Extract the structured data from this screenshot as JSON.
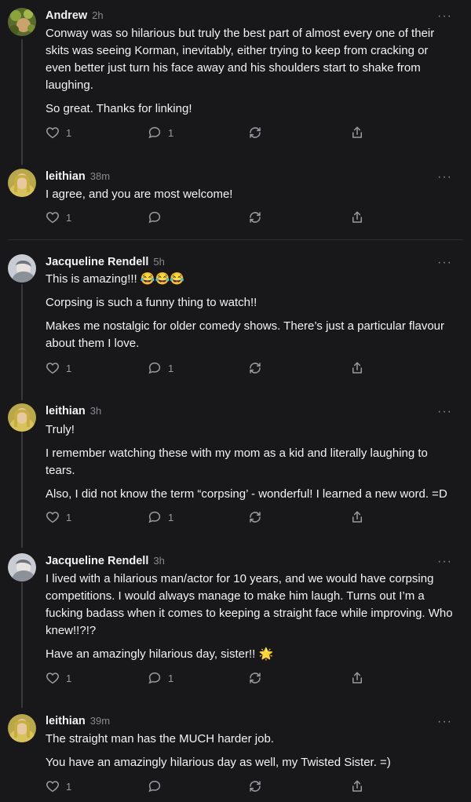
{
  "comments": [
    {
      "author": "Andrew",
      "time": "2h",
      "paragraphs": [
        "Conway was so hilarious but truly the best part of almost every one of their skits was seeing Korman, inevitably, either trying to keep from cracking or even better just turn his face away and his shoulders start to shake from laughing.",
        "So great. Thanks for linking!"
      ],
      "likes": "1",
      "replies": "1",
      "avatar": "leafy-avatar"
    },
    {
      "author": "leithian",
      "time": "38m",
      "paragraphs": [
        "I agree, and you are most welcome!"
      ],
      "likes": "1",
      "replies": "",
      "avatar": "blonde-avatar"
    },
    {
      "author": "Jacqueline Rendell",
      "time": "5h",
      "paragraphs": [
        "This is amazing!!! 😂😂😂",
        "Corpsing is such a funny thing to watch!!",
        "Makes me nostalgic for older comedy shows. There’s just a particular flavour about them I love."
      ],
      "likes": "1",
      "replies": "1",
      "avatar": "gray-avatar"
    },
    {
      "author": "leithian",
      "time": "3h",
      "paragraphs": [
        "Truly!",
        "I remember watching these with my mom as a kid and literally laughing to tears.",
        "Also, I did not know the term “corpsing’ - wonderful! I learned a new word. =D"
      ],
      "likes": "1",
      "replies": "1",
      "avatar": "blonde-avatar"
    },
    {
      "author": "Jacqueline Rendell",
      "time": "3h",
      "paragraphs": [
        "I lived with a hilarious man/actor for 10 years, and we would have corpsing competitions. I would always manage to make him laugh. Turns out I’m a fucking badass when it comes to keeping a straight face while improving. Who knew!!?!?",
        "Have an amazingly hilarious day, sister!! 🌟"
      ],
      "likes": "1",
      "replies": "1",
      "avatar": "gray-avatar"
    },
    {
      "author": "leithian",
      "time": "39m",
      "paragraphs": [
        "The straight man has the MUCH harder job.",
        "You have an amazingly hilarious day as well, my Twisted Sister. =)"
      ],
      "likes": "1",
      "replies": "",
      "avatar": "blonde-avatar"
    }
  ],
  "icons": {
    "like": "heart-icon",
    "reply": "comment-icon",
    "restack": "restack-icon",
    "share": "share-icon",
    "more": "more-options-icon"
  },
  "colors": {
    "background": "#18181a",
    "text": "#f3f3f3",
    "muted": "#8a8a8e",
    "thread_line": "#3a3a3c"
  }
}
